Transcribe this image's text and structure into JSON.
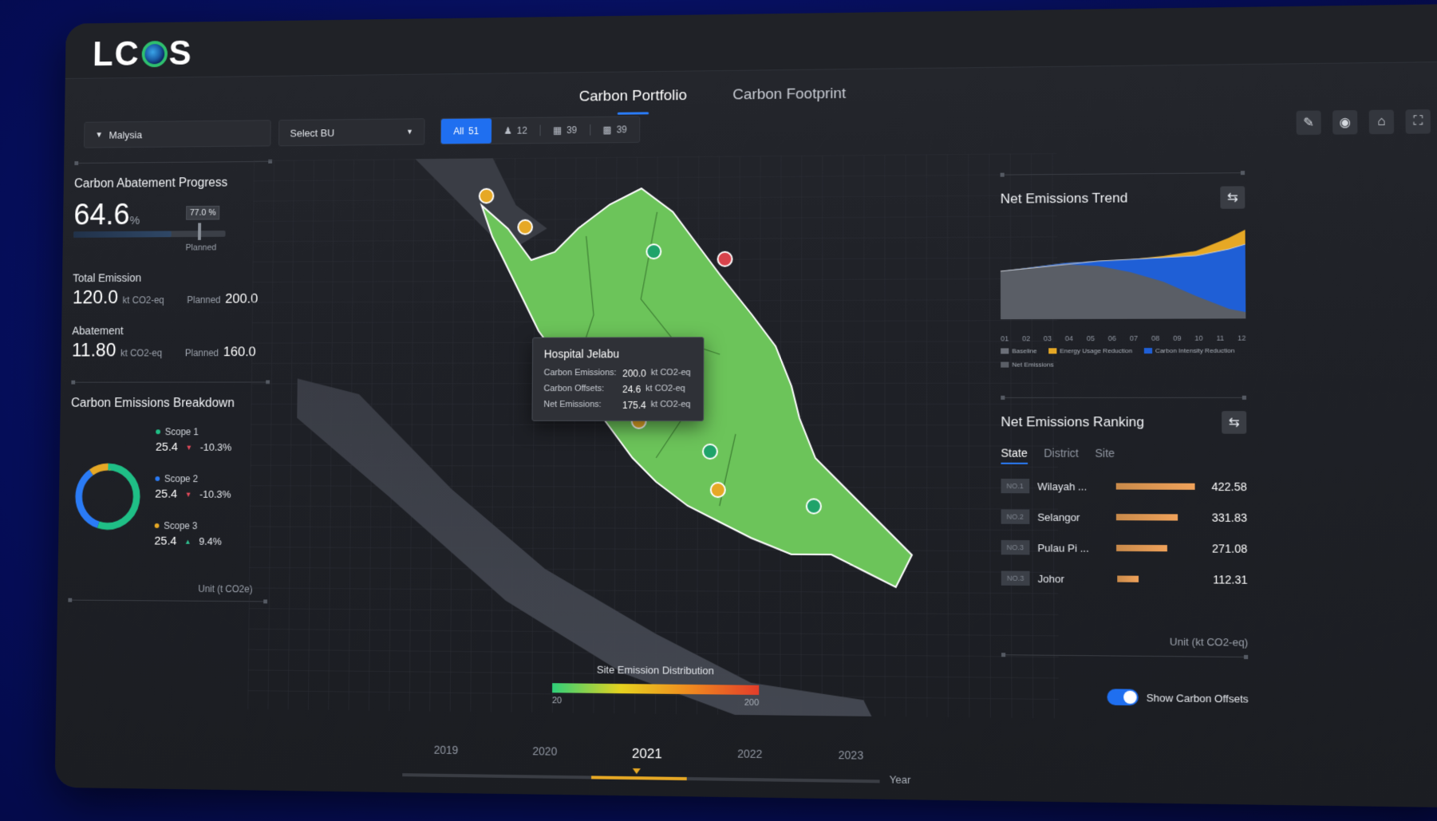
{
  "app": {
    "logo": "LCOS"
  },
  "tabs": [
    {
      "label": "Carbon Portfolio",
      "active": true
    },
    {
      "label": "Carbon Footprint",
      "active": false
    }
  ],
  "filters": {
    "country": "Malysia",
    "bu_placeholder": "Select BU",
    "segments": [
      {
        "label": "All",
        "count": "51",
        "icon": "all-icon"
      },
      {
        "label": "",
        "count": "12",
        "icon": "people-icon"
      },
      {
        "label": "",
        "count": "39",
        "icon": "building-icon"
      },
      {
        "label": "",
        "count": "39",
        "icon": "factory-icon"
      }
    ]
  },
  "tools": [
    "edit-icon",
    "location-icon",
    "home-icon",
    "fullscreen-icon"
  ],
  "abatement": {
    "title": "Carbon Abatement Progress",
    "value": "64.6",
    "unit": "%",
    "planned_tag": "77.0 %",
    "planned_label": "Planned",
    "progress": 0.646,
    "planned": 0.77
  },
  "total_emission": {
    "label": "Total Emission",
    "value": "120.0",
    "unit": "kt CO2-eq",
    "planned_label": "Planned",
    "planned_value": "200.0"
  },
  "abatement_metric": {
    "label": "Abatement",
    "value": "11.80",
    "unit": "kt CO2-eq",
    "planned_label": "Planned",
    "planned_value": "160.0"
  },
  "breakdown": {
    "title": "Carbon Emissions Breakdown",
    "scopes": [
      {
        "name": "Scope 1",
        "value": "25.4",
        "change": "-10.3%",
        "direction": "down",
        "color": "#1fbf86"
      },
      {
        "name": "Scope 2",
        "value": "25.4",
        "change": "-10.3%",
        "direction": "down",
        "color": "#2a7bf6"
      },
      {
        "name": "Scope 3",
        "value": "25.4",
        "change": "9.4%",
        "direction": "up",
        "color": "#e6a825"
      }
    ],
    "unit": "Unit  (t CO2e)"
  },
  "tooltip": {
    "title": "Hospital Jelabu",
    "rows": [
      {
        "key": "Carbon Emissions:",
        "value": "200.0",
        "unit": "kt CO2-eq"
      },
      {
        "key": "Carbon Offsets:",
        "value": "24.6",
        "unit": "kt CO2-eq"
      },
      {
        "key": "Net Emissions:",
        "value": "175.4",
        "unit": "kt CO2-eq"
      }
    ]
  },
  "distribution": {
    "title": "Site Emission Distribution",
    "min": "20",
    "max": "200"
  },
  "timeline": {
    "years": [
      "2019",
      "2020",
      "2021",
      "2022",
      "2023"
    ],
    "current": "2021",
    "axis_label": "Year"
  },
  "trend": {
    "title": "Net Emissions Trend",
    "months": [
      "01",
      "02",
      "03",
      "04",
      "05",
      "06",
      "07",
      "08",
      "09",
      "10",
      "11",
      "12"
    ],
    "legend": [
      "Baseline",
      "Energy Usage Reduction",
      "Carbon Intensity Reduction",
      "Net Emissions"
    ],
    "colors": {
      "baseline": "#6b6f78",
      "energy": "#e6a825",
      "intensity": "#1f5fd6",
      "net": "#5a5e66"
    }
  },
  "ranking": {
    "title": "Net Emissions Ranking",
    "tabs": [
      "State",
      "District",
      "Site"
    ],
    "rows": [
      {
        "no": "NO.1",
        "name": "Wilayah ...",
        "value": "422.58",
        "pct": 1.0
      },
      {
        "no": "NO.2",
        "name": "Selangor",
        "value": "331.83",
        "pct": 0.78
      },
      {
        "no": "NO.3",
        "name": "Pulau Pi ...",
        "value": "271.08",
        "pct": 0.64
      },
      {
        "no": "NO.3",
        "name": "Johor",
        "value": "112.31",
        "pct": 0.27
      }
    ],
    "unit": "Unit    (kt CO2-eq)"
  },
  "offsets_toggle": {
    "label": "Show Carbon Offsets",
    "on": true
  }
}
